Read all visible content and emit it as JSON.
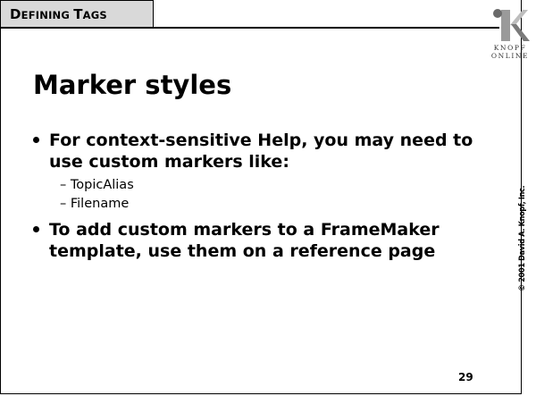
{
  "header": {
    "section_tag_first": "D",
    "section_tag_rest_1": "EFINING ",
    "section_tag_first_2": "T",
    "section_tag_rest_2": "AGS"
  },
  "logo": {
    "icon": "knopf-k-logo",
    "text_line1": "KNOPF",
    "text_line2": "ONLINE"
  },
  "slide": {
    "title": "Marker styles",
    "bullets": [
      {
        "text": "For context-sensitive Help, you may need to use custom markers like:",
        "sub_items": [
          "– TopicAlias",
          "– Filename"
        ]
      },
      {
        "text": "To add custom markers to a FrameMaker template, use them on a reference page",
        "sub_items": []
      }
    ]
  },
  "footer": {
    "page_number": "29",
    "copyright": "© 2001 David A. Knopf, Inc."
  }
}
